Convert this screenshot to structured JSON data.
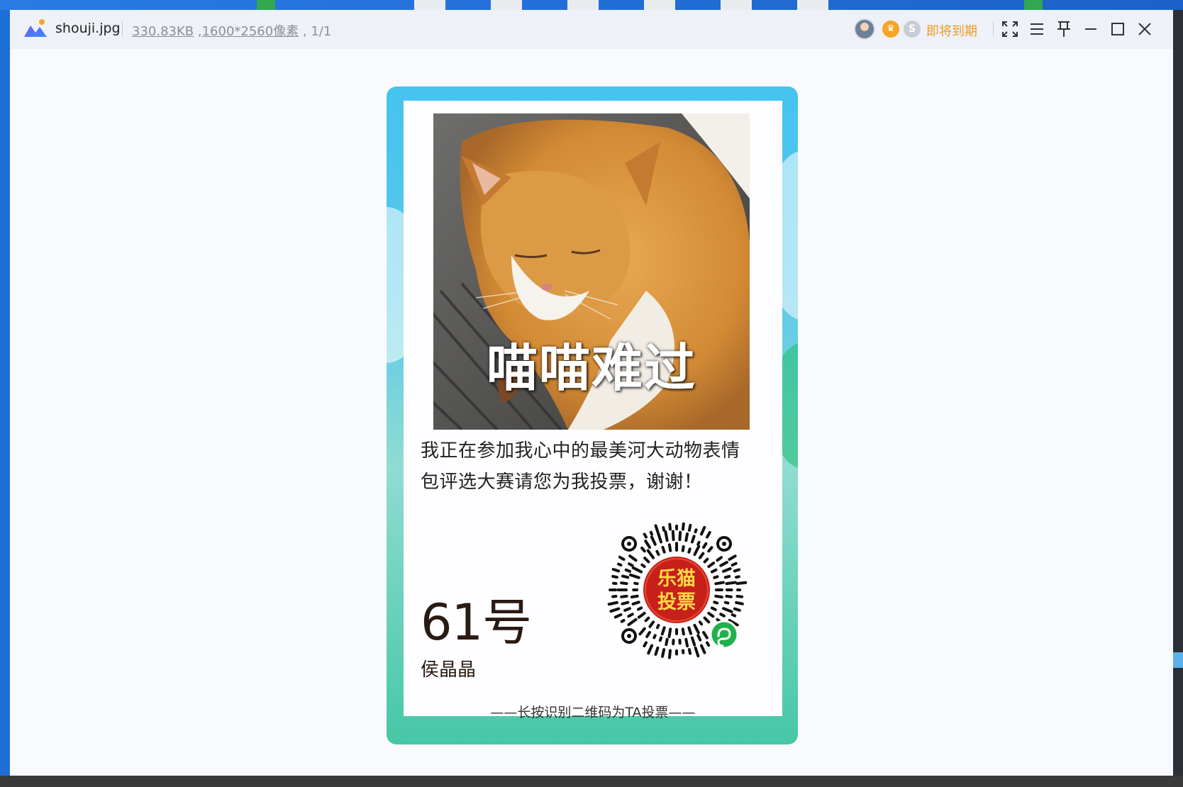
{
  "window": {
    "file_name": "shouji.jpg",
    "file_size": "330.83KB",
    "dimensions": "1600*2560像素",
    "page_counter": "1/1",
    "expire_text": "即将到期",
    "vip_icon": "crown-badge-icon",
    "svip_icon": "s-badge-icon"
  },
  "poster": {
    "meme_caption": "喵喵难过",
    "appeal_line1": "我正在参加我心中的最美河大动物表情",
    "appeal_line2": "包评选大赛请您为我投票，谢谢！",
    "entry_number": "61号",
    "entrant_name": "侯晶晶",
    "qr_center_line1": "乐猫",
    "qr_center_line2": "投票",
    "qr_instruction": "——长按识别二维码为TA投票——"
  },
  "colors": {
    "poster_top": "#45c3ee",
    "poster_bottom": "#46c7a6",
    "expire": "#f29a1f",
    "qr_seal": "#c7201a",
    "qr_seal_text": "#ffd84a",
    "miniapp_badge": "#21b14b"
  }
}
